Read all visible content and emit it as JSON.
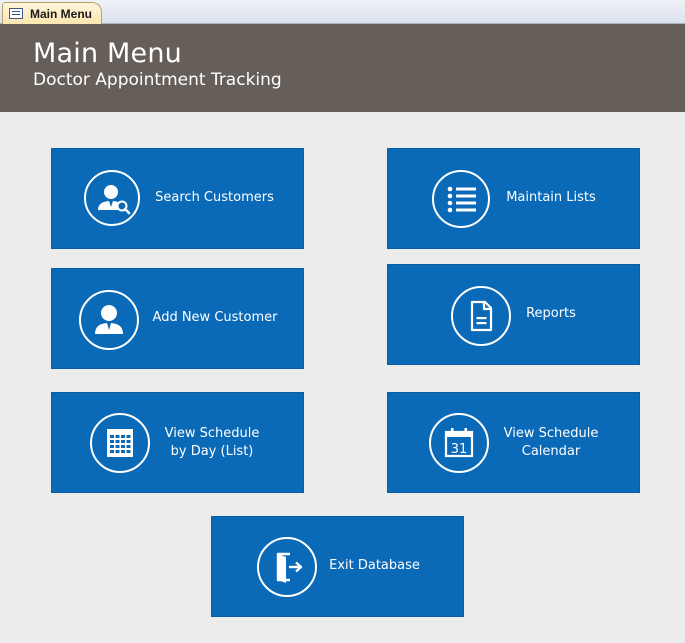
{
  "tab": {
    "label": "Main Menu",
    "icon": "form-icon"
  },
  "header": {
    "title": "Main Menu",
    "subtitle": "Doctor Appointment Tracking",
    "background_color": "#665f59"
  },
  "colors": {
    "button": "#0b6ab7",
    "page_background": "#ececec"
  },
  "buttons": {
    "search_customers": {
      "label": "Search Customers",
      "icon": "user-search-icon"
    },
    "maintain_lists": {
      "label": "Maintain Lists",
      "icon": "list-icon"
    },
    "add_new_customer": {
      "label": "Add New Customer",
      "icon": "user-icon"
    },
    "reports": {
      "label": "Reports",
      "icon": "document-icon"
    },
    "view_schedule_day": {
      "label": "View Schedule\nby Day (List)",
      "icon": "calendar-grid-icon"
    },
    "view_schedule_calendar": {
      "label": "View Schedule\nCalendar",
      "icon": "calendar-31-icon"
    },
    "exit_database": {
      "label": "Exit Database",
      "icon": "exit-door-icon"
    }
  }
}
